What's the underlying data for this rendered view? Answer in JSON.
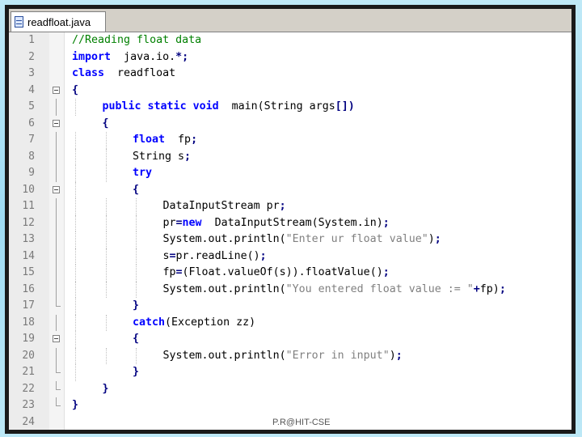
{
  "tab": {
    "title": "readfloat.java",
    "icon": "java-file-icon"
  },
  "footer": {
    "watermark": "P.R@HIT-CSE"
  },
  "lines": [
    {
      "n": "1",
      "indent": 0,
      "fold": "",
      "tokens": [
        [
          "cm",
          "//Reading float data"
        ]
      ]
    },
    {
      "n": "2",
      "indent": 0,
      "fold": "",
      "tokens": [
        [
          "kw",
          "import"
        ],
        [
          "",
          "  java.io."
        ],
        [
          "op",
          "*;"
        ]
      ]
    },
    {
      "n": "3",
      "indent": 0,
      "fold": "",
      "tokens": [
        [
          "kw",
          "class"
        ],
        [
          "",
          "  readfloat"
        ]
      ]
    },
    {
      "n": "4",
      "indent": 0,
      "fold": "open",
      "tokens": [
        [
          "op",
          "{"
        ]
      ]
    },
    {
      "n": "5",
      "indent": 1,
      "fold": "line",
      "tokens": [
        [
          "kw",
          "public static void"
        ],
        [
          "",
          "  main(String args"
        ],
        [
          "op",
          "[])"
        ]
      ]
    },
    {
      "n": "6",
      "indent": 1,
      "fold": "open",
      "tokens": [
        [
          "op",
          "{"
        ]
      ]
    },
    {
      "n": "7",
      "indent": 2,
      "fold": "line",
      "tokens": [
        [
          "kw",
          "float"
        ],
        [
          "",
          "  fp"
        ],
        [
          "op",
          ";"
        ]
      ]
    },
    {
      "n": "8",
      "indent": 2,
      "fold": "line",
      "tokens": [
        [
          "",
          "String s"
        ],
        [
          "op",
          ";"
        ]
      ]
    },
    {
      "n": "9",
      "indent": 2,
      "fold": "line",
      "tokens": [
        [
          "kw",
          "try"
        ]
      ]
    },
    {
      "n": "10",
      "indent": 2,
      "fold": "open",
      "tokens": [
        [
          "op",
          "{"
        ]
      ]
    },
    {
      "n": "11",
      "indent": 3,
      "fold": "line",
      "tokens": [
        [
          "",
          "DataInputStream pr"
        ],
        [
          "op",
          ";"
        ]
      ]
    },
    {
      "n": "12",
      "indent": 3,
      "fold": "line",
      "tokens": [
        [
          "",
          "pr"
        ],
        [
          "op",
          "="
        ],
        [
          "kw",
          "new"
        ],
        [
          "",
          "  DataInputStream(System.in)"
        ],
        [
          "op",
          ";"
        ]
      ]
    },
    {
      "n": "13",
      "indent": 3,
      "fold": "line",
      "tokens": [
        [
          "",
          "System.out.println("
        ],
        [
          "st",
          "\"Enter ur float value\""
        ],
        [
          "",
          ")"
        ],
        [
          "op",
          ";"
        ]
      ]
    },
    {
      "n": "14",
      "indent": 3,
      "fold": "line",
      "tokens": [
        [
          "",
          "s"
        ],
        [
          "op",
          "="
        ],
        [
          "",
          "pr.readLine()"
        ],
        [
          "op",
          ";"
        ]
      ]
    },
    {
      "n": "15",
      "indent": 3,
      "fold": "line",
      "tokens": [
        [
          "",
          "fp"
        ],
        [
          "op",
          "="
        ],
        [
          "",
          "(Float.valueOf(s)).floatValue()"
        ],
        [
          "op",
          ";"
        ]
      ]
    },
    {
      "n": "16",
      "indent": 3,
      "fold": "line",
      "tokens": [
        [
          "",
          "System.out.println("
        ],
        [
          "st",
          "\"You entered float value := \""
        ],
        [
          "op",
          "+"
        ],
        [
          "",
          "fp)"
        ],
        [
          "op",
          ";"
        ]
      ]
    },
    {
      "n": "17",
      "indent": 2,
      "fold": "end",
      "tokens": [
        [
          "op",
          "}"
        ]
      ]
    },
    {
      "n": "18",
      "indent": 2,
      "fold": "line",
      "tokens": [
        [
          "kw",
          "catch"
        ],
        [
          "",
          "(Exception zz)"
        ]
      ]
    },
    {
      "n": "19",
      "indent": 2,
      "fold": "open",
      "tokens": [
        [
          "op",
          "{"
        ]
      ]
    },
    {
      "n": "20",
      "indent": 3,
      "fold": "line",
      "tokens": [
        [
          "",
          "System.out.println("
        ],
        [
          "st",
          "\"Error in input\""
        ],
        [
          "",
          ")"
        ],
        [
          "op",
          ";"
        ]
      ]
    },
    {
      "n": "21",
      "indent": 2,
      "fold": "end",
      "tokens": [
        [
          "op",
          "}"
        ]
      ]
    },
    {
      "n": "22",
      "indent": 1,
      "fold": "end",
      "tokens": [
        [
          "op",
          "}"
        ]
      ]
    },
    {
      "n": "23",
      "indent": 0,
      "fold": "end",
      "tokens": [
        [
          "op",
          "}"
        ]
      ]
    },
    {
      "n": "24",
      "indent": 0,
      "fold": "",
      "tokens": []
    }
  ]
}
